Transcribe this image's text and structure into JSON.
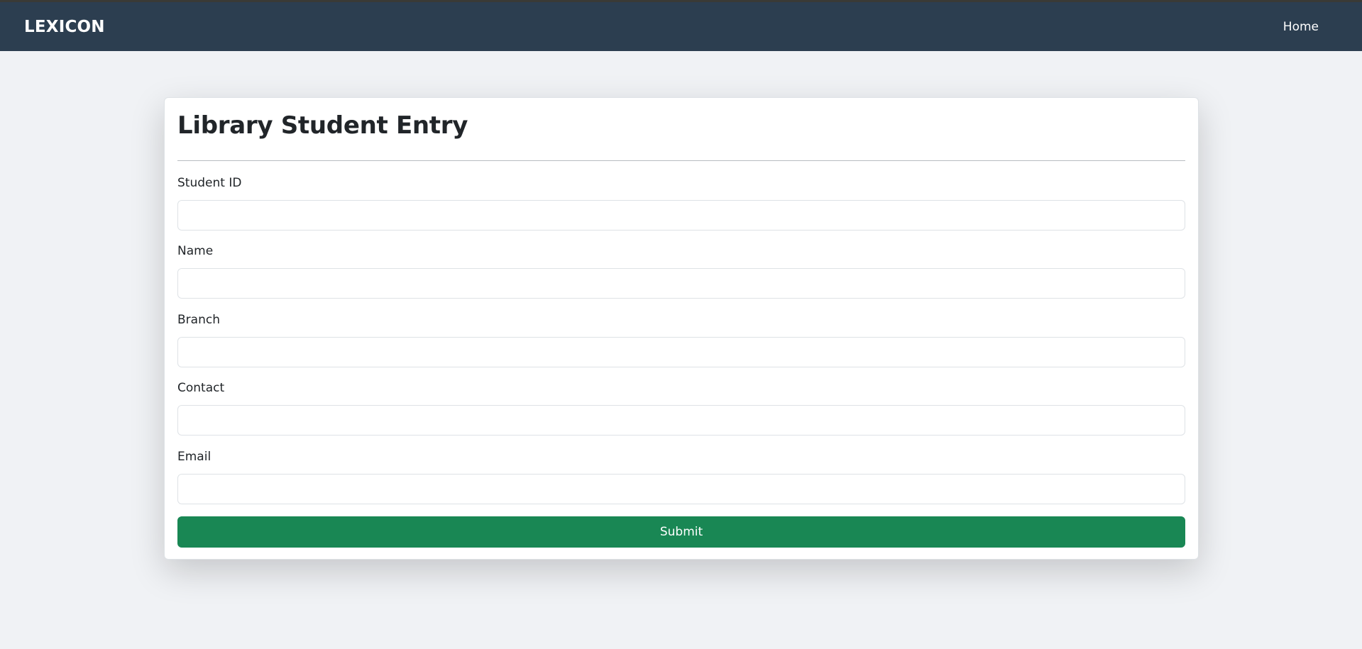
{
  "navbar": {
    "brand": "LEXICON",
    "links": [
      {
        "label": "Home"
      }
    ],
    "background_color": "#2c3e50"
  },
  "form": {
    "title": "Library Student Entry",
    "fields": [
      {
        "label": "Student ID",
        "value": "",
        "placeholder": ""
      },
      {
        "label": "Name",
        "value": "",
        "placeholder": ""
      },
      {
        "label": "Branch",
        "value": "",
        "placeholder": ""
      },
      {
        "label": "Contact",
        "value": "",
        "placeholder": ""
      },
      {
        "label": "Email",
        "value": "",
        "placeholder": ""
      }
    ],
    "submit_label": "Submit",
    "submit_color": "#198754"
  }
}
